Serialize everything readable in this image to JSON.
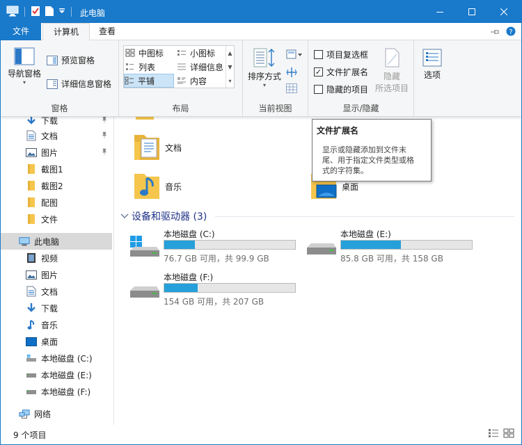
{
  "window": {
    "title": "此电脑",
    "minimize_glyph": "—",
    "maximize_glyph": "☐",
    "close_glyph": "✕"
  },
  "tabs": {
    "file": "文件",
    "computer": "计算机",
    "view": "查看"
  },
  "ribbon": {
    "panes": {
      "label": "窗格",
      "nav_pane": "导航窗格",
      "preview": "预览窗格",
      "details": "详细信息窗格"
    },
    "layout": {
      "label": "布局",
      "items": [
        "中图标",
        "小图标",
        "列表",
        "详细信息",
        "平铺",
        "内容"
      ]
    },
    "current_view": {
      "label": "当前视图",
      "sort": "排序方式"
    },
    "show_hide": {
      "label": "显示/隐藏",
      "item_checkboxes": "项目复选框",
      "file_extensions": "文件扩展名",
      "hidden_items": "隐藏的项目",
      "hide_selected_1": "隐藏",
      "hide_selected_2": "所选项目",
      "options": "选项"
    }
  },
  "nav": {
    "quick": [
      {
        "label": "下载",
        "icon": "download-icon"
      },
      {
        "label": "文档",
        "icon": "document-icon"
      },
      {
        "label": "图片",
        "icon": "picture-icon"
      },
      {
        "label": "截图1",
        "icon": "folder-icon"
      },
      {
        "label": "截图2",
        "icon": "folder-icon"
      },
      {
        "label": "配图",
        "icon": "folder-icon"
      },
      {
        "label": "文件",
        "icon": "folder-icon"
      }
    ],
    "this_pc": "此电脑",
    "pc_items": [
      {
        "label": "视频",
        "icon": "video-icon"
      },
      {
        "label": "图片",
        "icon": "picture-icon"
      },
      {
        "label": "文档",
        "icon": "document-icon"
      },
      {
        "label": "下载",
        "icon": "download-icon"
      },
      {
        "label": "音乐",
        "icon": "music-icon"
      },
      {
        "label": "桌面",
        "icon": "desktop-icon"
      },
      {
        "label": "本地磁盘 (C:)",
        "icon": "drive-c-icon"
      },
      {
        "label": "本地磁盘 (E:)",
        "icon": "drive-icon"
      },
      {
        "label": "本地磁盘 (F:)",
        "icon": "drive-icon"
      }
    ],
    "network": "网络"
  },
  "content": {
    "folders": [
      {
        "label": "文档",
        "icon": "document-folder-icon"
      },
      {
        "label": "音乐",
        "icon": "music-folder-icon"
      },
      {
        "label": "桌面",
        "icon": "desktop-folder-icon"
      }
    ],
    "devices_header": "设备和驱动器 (3)",
    "drives": [
      {
        "name": "本地磁盘 (C:)",
        "free": "76.7 GB 可用，共 99.9 GB",
        "used_fraction": 0.232
      },
      {
        "name": "本地磁盘 (E:)",
        "free": "85.8 GB 可用，共 158 GB",
        "used_fraction": 0.457
      },
      {
        "name": "本地磁盘 (F:)",
        "free": "154 GB 可用，共 207 GB",
        "used_fraction": 0.256
      }
    ]
  },
  "tooltip": {
    "title": "文件扩展名",
    "line1": "显示或隐藏添加到文件末",
    "line2": "尾、用于指定文件类型或格",
    "line3": "式的字符集。"
  },
  "status": {
    "count": "9 个项目"
  },
  "colors": {
    "accent": "#1979ca",
    "bar_fill": "#26a0da",
    "folder": "#f5c54c",
    "section_header": "#1e3287"
  }
}
